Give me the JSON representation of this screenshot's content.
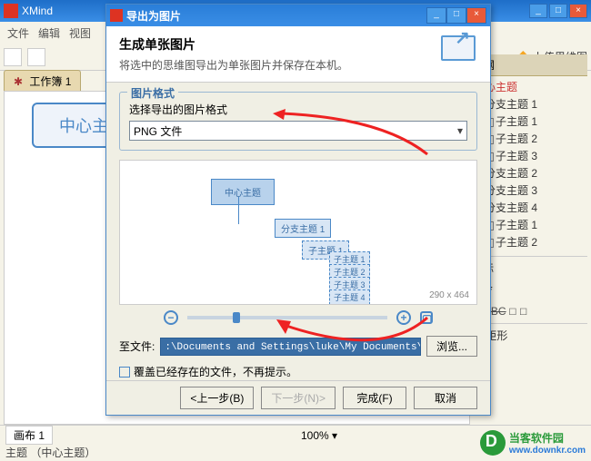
{
  "main": {
    "title": "XMind",
    "menus": [
      "文件",
      "编辑",
      "视图"
    ],
    "tab_label": "工作簿 1",
    "node_main": "中心主题",
    "upload_label": "上传思维图",
    "zoom_label": "100%",
    "sheet_tab": "画布 1",
    "footer": "主题 （中心主题）"
  },
  "sidebar": {
    "header": "大纲",
    "root": "中心主题",
    "branches": [
      "分支主题 1",
      "分支主题 2",
      "分支主题 3",
      "分支主题 4"
    ],
    "subs": [
      "子主题 1",
      "子主题 2",
      "子主题 3",
      "子主题 1",
      "子主题 2"
    ],
    "markers": "图标",
    "shape": "矩形"
  },
  "modal": {
    "title": "导出为图片",
    "heading": "生成单张图片",
    "sub": "将选中的思维图导出为单张图片并保存在本机。",
    "group_title": "图片格式",
    "group_label": "选择导出的图片格式",
    "format_value": "PNG 文件",
    "preview": {
      "main": "中心主题",
      "branch": "分支主题 1",
      "sub": "子主题 1",
      "leaves": [
        "子主题 1",
        "子主题 2",
        "子主题 3",
        "子主题 4"
      ],
      "dim": "290 x 464"
    },
    "file_label": "至文件:",
    "file_value": ":\\Documents and Settings\\luke\\My Documents\\中心主题.png",
    "browse": "浏览...",
    "overwrite": "覆盖已经存在的文件，不再提示。",
    "btn_back": "<上一步(B)",
    "btn_next": "下一步(N)>",
    "btn_finish": "完成(F)",
    "btn_cancel": "取消"
  },
  "logo": {
    "name": "当客软件园",
    "url": "www.downkr.com"
  }
}
